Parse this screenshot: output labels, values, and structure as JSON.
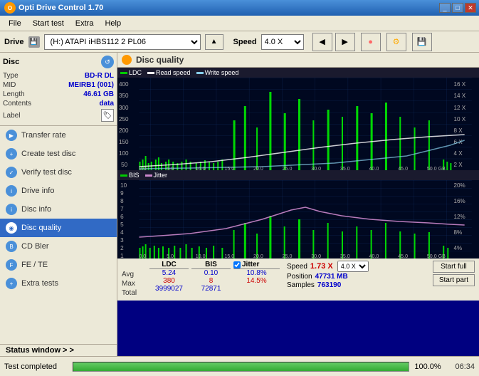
{
  "titleBar": {
    "title": "Opti Drive Control 1.70",
    "icon": "O",
    "buttons": [
      "_",
      "□",
      "✕"
    ]
  },
  "menuBar": {
    "items": [
      "File",
      "Start test",
      "Extra",
      "Help"
    ]
  },
  "driveBar": {
    "label": "Drive",
    "driveValue": "(H:)  ATAPI iHBS112  2 PL06",
    "speedLabel": "Speed",
    "speedValue": "4.0 X"
  },
  "disc": {
    "title": "Disc",
    "type": {
      "label": "Type",
      "value": "BD-R DL"
    },
    "mid": {
      "label": "MID",
      "value": "MEIRB1 (001)"
    },
    "length": {
      "label": "Length",
      "value": "46.61 GB"
    },
    "contents": {
      "label": "Contents",
      "value": "data"
    },
    "label": {
      "label": "Label",
      "value": ""
    }
  },
  "navItems": [
    {
      "id": "transfer-rate",
      "label": "Transfer rate"
    },
    {
      "id": "create-test-disc",
      "label": "Create test disc"
    },
    {
      "id": "verify-test-disc",
      "label": "Verify test disc"
    },
    {
      "id": "drive-info",
      "label": "Drive info"
    },
    {
      "id": "disc-info",
      "label": "Disc info"
    },
    {
      "id": "disc-quality",
      "label": "Disc quality",
      "active": true
    },
    {
      "id": "cd-bler",
      "label": "CD Bler"
    },
    {
      "id": "fe-te",
      "label": "FE / TE"
    },
    {
      "id": "extra-tests",
      "label": "Extra tests"
    }
  ],
  "statusWindow": {
    "label": "Status window > >"
  },
  "content": {
    "title": "Disc quality",
    "topLegend": [
      {
        "label": "LDC",
        "color": "#00cc00"
      },
      {
        "label": "Read speed",
        "color": "#ffffff"
      },
      {
        "label": "Write speed",
        "color": "#87ceeb"
      }
    ],
    "bottomLegend": [
      {
        "label": "BIS",
        "color": "#00cc00"
      },
      {
        "label": "Jitter",
        "color": "#cc88cc"
      }
    ],
    "topChart": {
      "yLabels": [
        "400",
        "350",
        "300",
        "250",
        "200",
        "150",
        "100",
        "50"
      ],
      "yLabelsRight": [
        "16 X",
        "14 X",
        "12 X",
        "10 X",
        "8 X",
        "6 X",
        "4 X",
        "2 X"
      ],
      "xLabels": [
        "0.0",
        "5.0",
        "10.0",
        "15.0",
        "20.0",
        "25.0",
        "30.0",
        "35.0",
        "40.0",
        "45.0",
        "50.0 GB"
      ]
    },
    "bottomChart": {
      "yLabels": [
        "10",
        "9",
        "8",
        "7",
        "6",
        "5",
        "4",
        "3",
        "2",
        "1"
      ],
      "yLabelsRight": [
        "20%",
        "16%",
        "12%",
        "8%",
        "4%"
      ],
      "xLabels": [
        "0.0",
        "5.0",
        "10.0",
        "15.0",
        "20.0",
        "25.0",
        "30.0",
        "35.0",
        "40.0",
        "45.0",
        "50.0 GB"
      ]
    }
  },
  "stats": {
    "ldc": {
      "label": "LDC",
      "avg": "5.24",
      "max": "380",
      "total": "3999027"
    },
    "bis": {
      "label": "BIS",
      "avg": "0.10",
      "max": "8",
      "total": "72871"
    },
    "jitter": {
      "label": "Jitter",
      "checked": true,
      "avg": "10.8%",
      "max": "14.5%",
      "total": ""
    },
    "speed": {
      "label": "Speed",
      "value": "1.73 X",
      "selectValue": "4.0 X"
    },
    "position": {
      "label": "Position",
      "value": "47731 MB"
    },
    "samples": {
      "label": "Samples",
      "value": "763190"
    },
    "buttons": {
      "startFull": "Start full",
      "startPart": "Start part"
    }
  },
  "bottomStatus": {
    "text": "Test completed",
    "progress": 100,
    "progressText": "100.0%",
    "time": "06:34"
  }
}
